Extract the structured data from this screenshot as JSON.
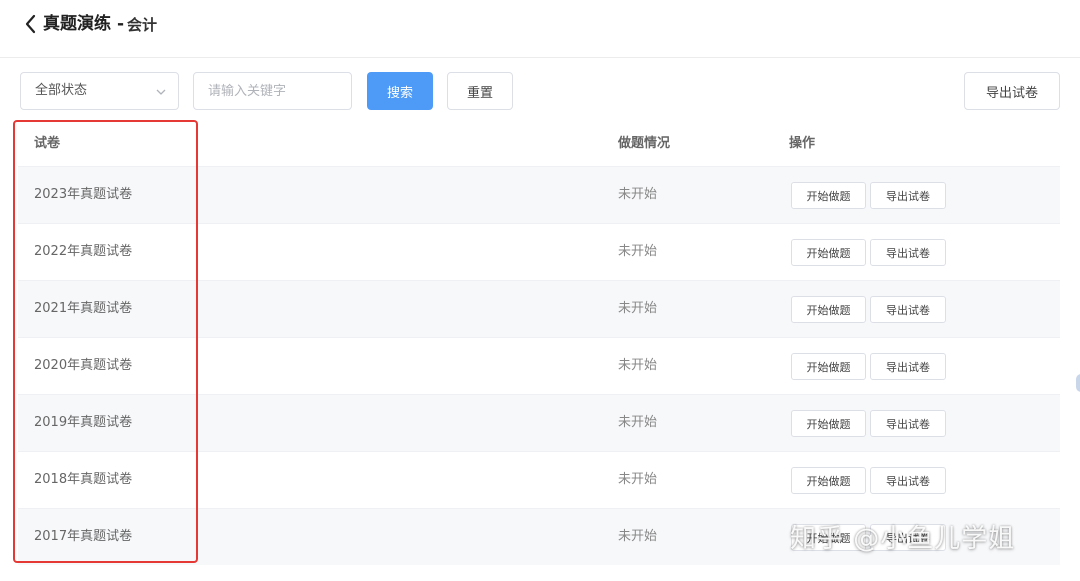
{
  "header": {
    "title": "真题演练",
    "separator": "-",
    "subtitle": "会计",
    "back_icon": "chevron-left-icon"
  },
  "filters": {
    "status_select": {
      "value": "全部状态",
      "icon": "chevron-down-icon"
    },
    "keyword_input": {
      "placeholder": "请输入关键字",
      "value": ""
    },
    "search_label": "搜索",
    "reset_label": "重置",
    "export_label": "导出试卷"
  },
  "colors": {
    "primary": "#4e9bf7",
    "highlight": "#e53935",
    "stripe": "#f7f8fa"
  },
  "table": {
    "columns": [
      "试卷",
      "做题情况",
      "操作"
    ],
    "rows": [
      {
        "title": "2023年真题试卷",
        "status": "未开始",
        "start_label": "开始做题",
        "export_label": "导出试卷"
      },
      {
        "title": "2022年真题试卷",
        "status": "未开始",
        "start_label": "开始做题",
        "export_label": "导出试卷"
      },
      {
        "title": "2021年真题试卷",
        "status": "未开始",
        "start_label": "开始做题",
        "export_label": "导出试卷"
      },
      {
        "title": "2020年真题试卷",
        "status": "未开始",
        "start_label": "开始做题",
        "export_label": "导出试卷"
      },
      {
        "title": "2019年真题试卷",
        "status": "未开始",
        "start_label": "开始做题",
        "export_label": "导出试卷"
      },
      {
        "title": "2018年真题试卷",
        "status": "未开始",
        "start_label": "开始做题",
        "export_label": "导出试卷"
      },
      {
        "title": "2017年真题试卷",
        "status": "未开始",
        "start_label": "开始做题",
        "export_label": "导出试卷"
      }
    ]
  },
  "watermark": "知乎 @小鱼儿学姐"
}
